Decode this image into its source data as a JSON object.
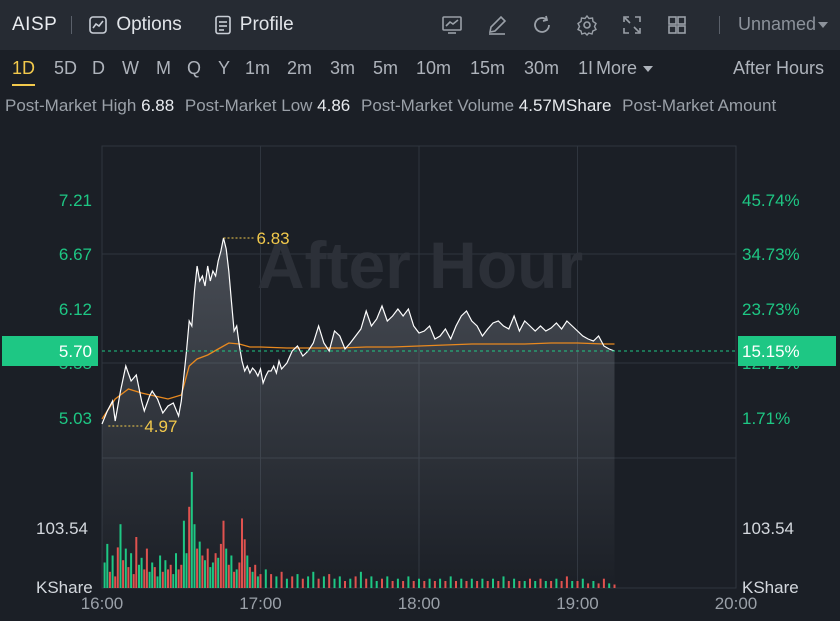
{
  "header": {
    "ticker": "AISP",
    "options_label": "Options",
    "profile_label": "Profile",
    "layout_name": "Unnamed"
  },
  "periods": [
    "1D",
    "5D",
    "D",
    "W",
    "M",
    "Q",
    "Y",
    "1m",
    "2m",
    "3m",
    "5m",
    "10m",
    "15m",
    "30m",
    "1I",
    "More"
  ],
  "active_period": "1D",
  "session_selector": "After Hours",
  "stats": [
    {
      "label": "Post-Market High",
      "value": "6.88"
    },
    {
      "label": "Post-Market Low",
      "value": "4.86"
    },
    {
      "label": "Post-Market Volume",
      "value": "4.57MShare"
    },
    {
      "label": "Post-Market Amount",
      "value": ""
    }
  ],
  "colors": {
    "up": "#1ec784",
    "down": "#e0524f",
    "accent": "#f2c94c",
    "line": "#ffffff",
    "avg": "#e8891f"
  },
  "chart_data": {
    "type": "line",
    "watermark": "After Hour",
    "x_ticks": [
      "16:00",
      "17:00",
      "18:00",
      "19:00",
      "20:00"
    ],
    "x_range": [
      0,
      240
    ],
    "y_price_ticks": [
      "7.21",
      "6.67",
      "6.12",
      "5.58",
      "5.03"
    ],
    "y_pct_ticks": [
      "45.74%",
      "34.73%",
      "23.73%",
      "12.72%",
      "1.71%"
    ],
    "y_range": [
      4.75,
      7.75
    ],
    "current_price": "5.70",
    "current_pct": "15.15%",
    "high_label": "6.83",
    "low_label": "4.97",
    "high_point": [
      46,
      6.83
    ],
    "low_point": [
      13,
      4.97
    ],
    "volume_label": "103.54",
    "volume_unit": "KShare",
    "price_series": [
      [
        0,
        4.97
      ],
      [
        2,
        5.1
      ],
      [
        4,
        5.2
      ],
      [
        5,
        5.0
      ],
      [
        7,
        5.3
      ],
      [
        9,
        5.55
      ],
      [
        11,
        5.4
      ],
      [
        13,
        5.46
      ],
      [
        15,
        5.2
      ],
      [
        16,
        5.1
      ],
      [
        18,
        5.25
      ],
      [
        19,
        5.3
      ],
      [
        21,
        5.22
      ],
      [
        23,
        5.08
      ],
      [
        25,
        5.15
      ],
      [
        27,
        5.18
      ],
      [
        29,
        5.05
      ],
      [
        30,
        5.2
      ],
      [
        32,
        5.7
      ],
      [
        33,
        6.0
      ],
      [
        34,
        5.95
      ],
      [
        35,
        6.3
      ],
      [
        36,
        6.55
      ],
      [
        37,
        6.4
      ],
      [
        38,
        6.45
      ],
      [
        39,
        6.35
      ],
      [
        40,
        6.55
      ],
      [
        41,
        6.4
      ],
      [
        42,
        6.5
      ],
      [
        43,
        6.45
      ],
      [
        44,
        6.6
      ],
      [
        45,
        6.7
      ],
      [
        46,
        6.83
      ],
      [
        47,
        6.72
      ],
      [
        48,
        6.5
      ],
      [
        49,
        6.2
      ],
      [
        50,
        5.9
      ],
      [
        51,
        5.95
      ],
      [
        52,
        5.75
      ],
      [
        53,
        5.6
      ],
      [
        54,
        5.5
      ],
      [
        55,
        5.55
      ],
      [
        56,
        5.48
      ],
      [
        57,
        5.53
      ],
      [
        58,
        5.5
      ],
      [
        59,
        5.45
      ],
      [
        60,
        5.52
      ],
      [
        61,
        5.38
      ],
      [
        62,
        5.45
      ],
      [
        63,
        5.5
      ],
      [
        64,
        5.5
      ],
      [
        65,
        5.55
      ],
      [
        66,
        5.48
      ],
      [
        67,
        5.6
      ],
      [
        68,
        5.52
      ],
      [
        70,
        5.58
      ],
      [
        72,
        5.7
      ],
      [
        74,
        5.75
      ],
      [
        76,
        5.65
      ],
      [
        78,
        5.7
      ],
      [
        80,
        5.78
      ],
      [
        82,
        5.95
      ],
      [
        84,
        5.78
      ],
      [
        86,
        5.7
      ],
      [
        88,
        5.9
      ],
      [
        90,
        5.85
      ],
      [
        92,
        5.72
      ],
      [
        94,
        5.78
      ],
      [
        96,
        5.85
      ],
      [
        98,
        5.92
      ],
      [
        100,
        6.1
      ],
      [
        102,
        5.95
      ],
      [
        104,
        6.02
      ],
      [
        106,
        6.15
      ],
      [
        108,
        6.0
      ],
      [
        110,
        6.05
      ],
      [
        112,
        6.12
      ],
      [
        114,
        6.05
      ],
      [
        116,
        6.12
      ],
      [
        118,
        5.95
      ],
      [
        120,
        5.88
      ],
      [
        122,
        5.9
      ],
      [
        124,
        5.95
      ],
      [
        126,
        5.82
      ],
      [
        128,
        5.85
      ],
      [
        130,
        5.92
      ],
      [
        132,
        5.82
      ],
      [
        134,
        5.95
      ],
      [
        136,
        6.05
      ],
      [
        138,
        6.1
      ],
      [
        140,
        6.0
      ],
      [
        142,
        5.95
      ],
      [
        144,
        5.85
      ],
      [
        146,
        5.92
      ],
      [
        148,
        5.98
      ],
      [
        150,
        6.0
      ],
      [
        152,
        5.95
      ],
      [
        154,
        5.92
      ],
      [
        156,
        6.05
      ],
      [
        158,
        5.9
      ],
      [
        160,
        6.0
      ],
      [
        162,
        5.95
      ],
      [
        164,
        5.9
      ],
      [
        166,
        5.95
      ],
      [
        168,
        5.9
      ],
      [
        170,
        5.93
      ],
      [
        172,
        5.98
      ],
      [
        174,
        5.92
      ],
      [
        176,
        6.0
      ],
      [
        178,
        5.95
      ],
      [
        180,
        5.9
      ],
      [
        182,
        5.85
      ],
      [
        184,
        5.82
      ],
      [
        186,
        5.8
      ],
      [
        188,
        5.85
      ],
      [
        190,
        5.75
      ],
      [
        192,
        5.72
      ],
      [
        194,
        5.7
      ]
    ],
    "avg_series": [
      [
        0,
        5.02
      ],
      [
        5,
        5.22
      ],
      [
        10,
        5.32
      ],
      [
        15,
        5.28
      ],
      [
        20,
        5.25
      ],
      [
        25,
        5.22
      ],
      [
        30,
        5.26
      ],
      [
        33,
        5.55
      ],
      [
        36,
        5.62
      ],
      [
        40,
        5.66
      ],
      [
        44,
        5.72
      ],
      [
        48,
        5.78
      ],
      [
        52,
        5.77
      ],
      [
        56,
        5.74
      ],
      [
        60,
        5.74
      ],
      [
        70,
        5.73
      ],
      [
        80,
        5.73
      ],
      [
        90,
        5.73
      ],
      [
        100,
        5.74
      ],
      [
        110,
        5.74
      ],
      [
        120,
        5.75
      ],
      [
        130,
        5.76
      ],
      [
        140,
        5.77
      ],
      [
        150,
        5.77
      ],
      [
        160,
        5.77
      ],
      [
        170,
        5.78
      ],
      [
        180,
        5.78
      ],
      [
        190,
        5.77
      ],
      [
        194,
        5.77
      ]
    ],
    "volume_series": [
      [
        1,
        22,
        1
      ],
      [
        2,
        38,
        1
      ],
      [
        3,
        14,
        0
      ],
      [
        4,
        28,
        1
      ],
      [
        5,
        10,
        0
      ],
      [
        6,
        35,
        0
      ],
      [
        7,
        55,
        1
      ],
      [
        8,
        24,
        0
      ],
      [
        9,
        34,
        1
      ],
      [
        10,
        18,
        0
      ],
      [
        11,
        30,
        1
      ],
      [
        12,
        12,
        0
      ],
      [
        13,
        44,
        0
      ],
      [
        14,
        20,
        1
      ],
      [
        15,
        26,
        1
      ],
      [
        16,
        16,
        0
      ],
      [
        17,
        34,
        0
      ],
      [
        18,
        14,
        1
      ],
      [
        19,
        22,
        1
      ],
      [
        20,
        18,
        0
      ],
      [
        21,
        10,
        1
      ],
      [
        22,
        28,
        1
      ],
      [
        23,
        14,
        0
      ],
      [
        24,
        24,
        1
      ],
      [
        25,
        16,
        0
      ],
      [
        26,
        20,
        0
      ],
      [
        27,
        12,
        1
      ],
      [
        28,
        30,
        1
      ],
      [
        29,
        16,
        0
      ],
      [
        30,
        20,
        0
      ],
      [
        31,
        58,
        1
      ],
      [
        32,
        30,
        1
      ],
      [
        33,
        70,
        0
      ],
      [
        34,
        100,
        1
      ],
      [
        35,
        55,
        1
      ],
      [
        36,
        34,
        0
      ],
      [
        37,
        40,
        1
      ],
      [
        38,
        28,
        0
      ],
      [
        39,
        24,
        1
      ],
      [
        40,
        34,
        0
      ],
      [
        41,
        18,
        1
      ],
      [
        42,
        22,
        1
      ],
      [
        43,
        30,
        0
      ],
      [
        44,
        26,
        1
      ],
      [
        45,
        38,
        0
      ],
      [
        46,
        58,
        0
      ],
      [
        47,
        34,
        1
      ],
      [
        48,
        20,
        0
      ],
      [
        49,
        28,
        1
      ],
      [
        50,
        14,
        0
      ],
      [
        51,
        16,
        1
      ],
      [
        52,
        22,
        0
      ],
      [
        53,
        60,
        0
      ],
      [
        54,
        42,
        0
      ],
      [
        55,
        28,
        1
      ],
      [
        56,
        18,
        0
      ],
      [
        57,
        14,
        1
      ],
      [
        58,
        20,
        0
      ],
      [
        59,
        10,
        1
      ],
      [
        60,
        12,
        0
      ],
      [
        62,
        16,
        1
      ],
      [
        64,
        12,
        0
      ],
      [
        66,
        10,
        1
      ],
      [
        68,
        14,
        0
      ],
      [
        70,
        8,
        1
      ],
      [
        72,
        10,
        0
      ],
      [
        74,
        12,
        1
      ],
      [
        76,
        8,
        0
      ],
      [
        78,
        10,
        1
      ],
      [
        80,
        14,
        1
      ],
      [
        82,
        8,
        0
      ],
      [
        84,
        10,
        1
      ],
      [
        86,
        12,
        0
      ],
      [
        88,
        8,
        1
      ],
      [
        90,
        10,
        1
      ],
      [
        92,
        6,
        0
      ],
      [
        94,
        8,
        1
      ],
      [
        96,
        10,
        0
      ],
      [
        98,
        14,
        1
      ],
      [
        100,
        8,
        0
      ],
      [
        102,
        10,
        1
      ],
      [
        104,
        6,
        1
      ],
      [
        106,
        8,
        0
      ],
      [
        108,
        10,
        1
      ],
      [
        110,
        6,
        0
      ],
      [
        112,
        8,
        1
      ],
      [
        114,
        6,
        0
      ],
      [
        116,
        10,
        1
      ],
      [
        118,
        6,
        0
      ],
      [
        120,
        8,
        1
      ],
      [
        122,
        6,
        0
      ],
      [
        124,
        8,
        1
      ],
      [
        126,
        6,
        0
      ],
      [
        128,
        8,
        1
      ],
      [
        130,
        6,
        0
      ],
      [
        132,
        10,
        1
      ],
      [
        134,
        6,
        0
      ],
      [
        136,
        8,
        1
      ],
      [
        138,
        6,
        0
      ],
      [
        140,
        8,
        1
      ],
      [
        142,
        6,
        0
      ],
      [
        144,
        8,
        1
      ],
      [
        146,
        6,
        0
      ],
      [
        148,
        8,
        1
      ],
      [
        150,
        6,
        0
      ],
      [
        152,
        10,
        1
      ],
      [
        154,
        6,
        0
      ],
      [
        156,
        8,
        1
      ],
      [
        158,
        6,
        0
      ],
      [
        160,
        6,
        1
      ],
      [
        162,
        8,
        0
      ],
      [
        164,
        6,
        1
      ],
      [
        166,
        8,
        0
      ],
      [
        168,
        6,
        1
      ],
      [
        170,
        6,
        0
      ],
      [
        172,
        8,
        1
      ],
      [
        174,
        6,
        0
      ],
      [
        176,
        10,
        0
      ],
      [
        178,
        6,
        1
      ],
      [
        180,
        6,
        0
      ],
      [
        182,
        8,
        1
      ],
      [
        184,
        4,
        0
      ],
      [
        186,
        6,
        1
      ],
      [
        188,
        4,
        0
      ],
      [
        190,
        8,
        0
      ],
      [
        192,
        4,
        1
      ],
      [
        194,
        3,
        0
      ]
    ],
    "volume_max": 100
  }
}
